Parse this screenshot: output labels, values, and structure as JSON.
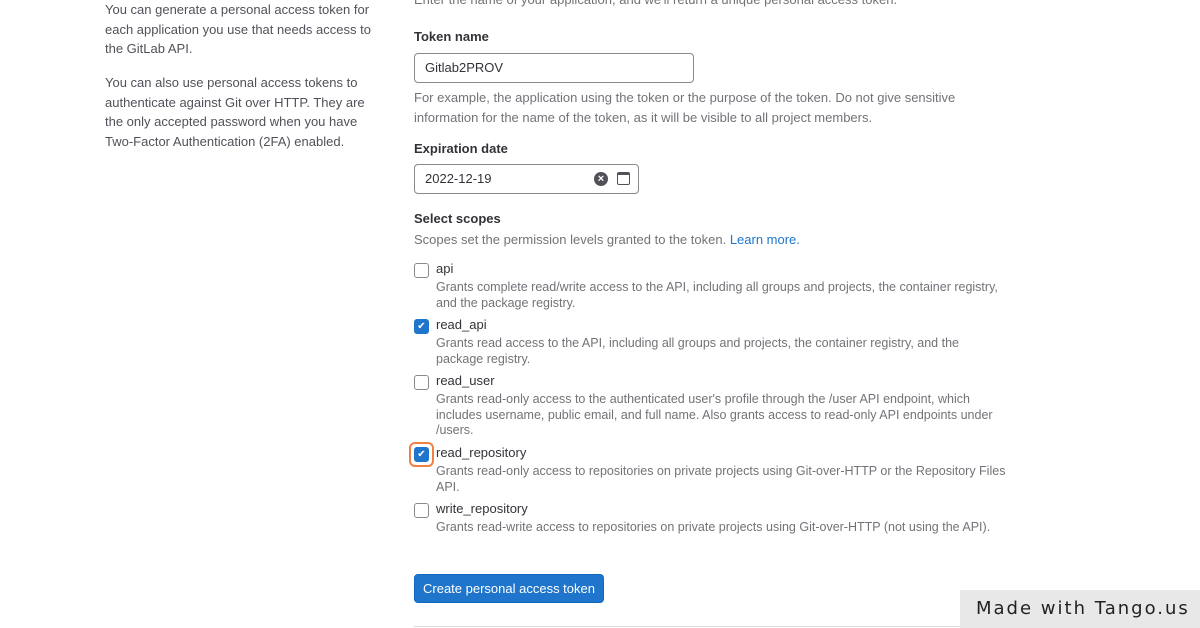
{
  "sidebar": {
    "para1": "You can generate a personal access token for each application you use that needs access to the GitLab API.",
    "para2": "You can also use personal access tokens to authenticate against Git over HTTP. They are the only accepted password when you have Two-Factor Authentication (2FA) enabled."
  },
  "form": {
    "intro": "Enter the name of your application, and we'll return a unique personal access token.",
    "token_name_label": "Token name",
    "token_name_value": "Gitlab2PROV",
    "token_name_help": "For example, the application using the token or the purpose of the token. Do not give sensitive information for the name of the token, as it will be visible to all project members.",
    "expiration_label": "Expiration date",
    "expiration_value": "2022-12-19",
    "scopes_label": "Select scopes",
    "scopes_help": "Scopes set the permission levels granted to the token.",
    "learn_more": "Learn more.",
    "scopes": [
      {
        "name": "api",
        "checked": false,
        "desc": "Grants complete read/write access to the API, including all groups and projects, the container registry, and the package registry."
      },
      {
        "name": "read_api",
        "checked": true,
        "desc": "Grants read access to the API, including all groups and projects, the container registry, and the package registry."
      },
      {
        "name": "read_user",
        "checked": false,
        "desc": "Grants read-only access to the authenticated user's profile through the /user API endpoint, which includes username, public email, and full name. Also grants access to read-only API endpoints under /users."
      },
      {
        "name": "read_repository",
        "checked": true,
        "focused": true,
        "desc": "Grants read-only access to repositories on private projects using Git-over-HTTP or the Repository Files API."
      },
      {
        "name": "write_repository",
        "checked": false,
        "desc": "Grants read-write access to repositories on private projects using Git-over-HTTP (not using the API)."
      }
    ],
    "submit_label": "Create personal access token"
  },
  "watermark": "Made with Tango.us",
  "colors": {
    "primary": "#1f75cb",
    "highlight": "#f27f44",
    "link": "#1f75cb"
  }
}
